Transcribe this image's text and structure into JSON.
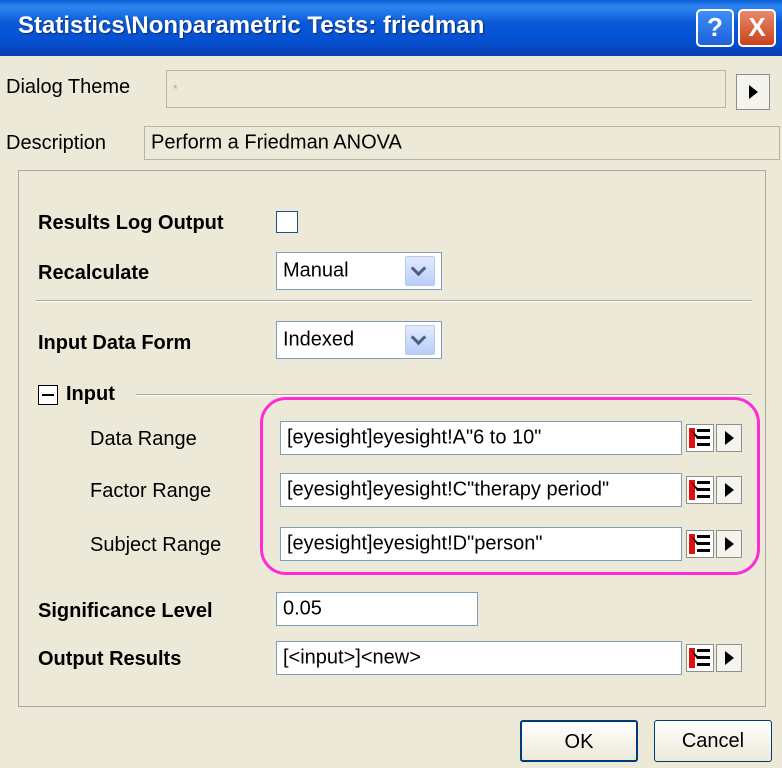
{
  "window": {
    "title": "Statistics\\Nonparametric Tests: friedman",
    "help_label": "?",
    "close_label": "X"
  },
  "dialog_theme": {
    "label": "Dialog Theme",
    "value": "*"
  },
  "description": {
    "label": "Description",
    "value": "Perform a Friedman ANOVA"
  },
  "results_log_output": {
    "label": "Results Log Output",
    "checked": false
  },
  "recalculate": {
    "label": "Recalculate",
    "value": "Manual"
  },
  "input_data_form": {
    "label": "Input Data Form",
    "value": "Indexed"
  },
  "input_group": {
    "label": "Input",
    "data_range": {
      "label": "Data Range",
      "value": "[eyesight]eyesight!A\"6 to 10\""
    },
    "factor_range": {
      "label": "Factor Range",
      "value": "[eyesight]eyesight!C\"therapy period\""
    },
    "subject_range": {
      "label": "Subject Range",
      "value": "[eyesight]eyesight!D\"person\""
    }
  },
  "significance_level": {
    "label": "Significance Level",
    "value": "0.05"
  },
  "output_results": {
    "label": "Output Results",
    "value": "[<input>]<new>"
  },
  "buttons": {
    "ok": "OK",
    "cancel": "Cancel"
  },
  "colors": {
    "highlight": "#ff2bd6",
    "titlebar": "#0a5fd6",
    "dialog_bg": "#ece9d8"
  }
}
